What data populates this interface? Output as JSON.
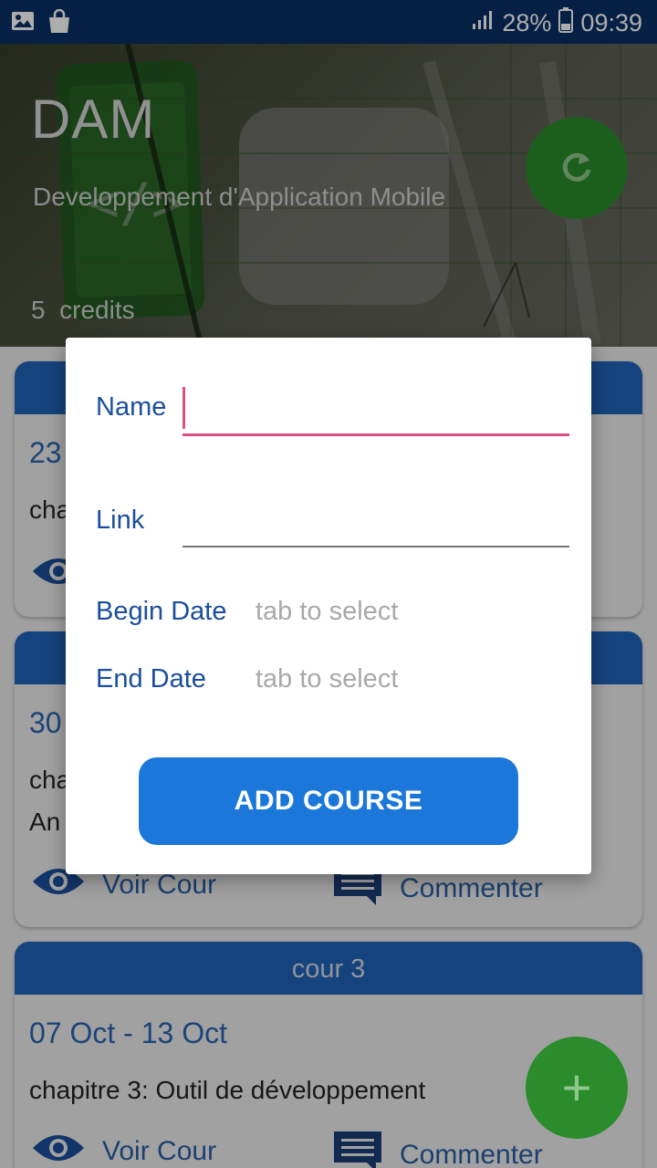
{
  "status_bar": {
    "battery_percent": "28%",
    "time": "09:39",
    "left_icons": [
      "image-icon",
      "shopping-bag-icon"
    ],
    "right_icons": [
      "signal-icon",
      "battery-icon"
    ]
  },
  "header": {
    "title": "DAM",
    "subtitle": "Developpement d'Application Mobile",
    "credits_value": "5",
    "credits_label": "credits",
    "refresh_icon": "refresh-icon"
  },
  "cards": [
    {
      "title": "",
      "date": "23",
      "chapter_lines": [
        "cha"
      ],
      "view_label": "",
      "comment_label": ""
    },
    {
      "title": "",
      "date": "30",
      "chapter_lines": [
        "cha",
        "An"
      ],
      "view_label": "Voir Cour",
      "comment_label": "Commenter"
    },
    {
      "title": "cour 3",
      "date": "07 Oct - 13 Oct",
      "chapter_lines": [
        "chapitre 3: Outil de développement"
      ],
      "view_label": "Voir Cour",
      "comment_label": "Commenter"
    }
  ],
  "dialog": {
    "name_label": "Name",
    "name_value": "",
    "link_label": "Link",
    "link_value": "",
    "begin_label": "Begin Date",
    "begin_value": "tab to select",
    "end_label": "End Date",
    "end_value": "tab to select",
    "submit_label": "ADD COURSE"
  },
  "fab": {
    "icon": "plus-icon",
    "symbol": "+"
  },
  "colors": {
    "status_bar": "#0a2f66",
    "primary": "#1b77d9",
    "card_header": "#1f63b8",
    "label": "#1b4e9c",
    "accent": "#e14d85",
    "fab": "#2a8c2b"
  }
}
